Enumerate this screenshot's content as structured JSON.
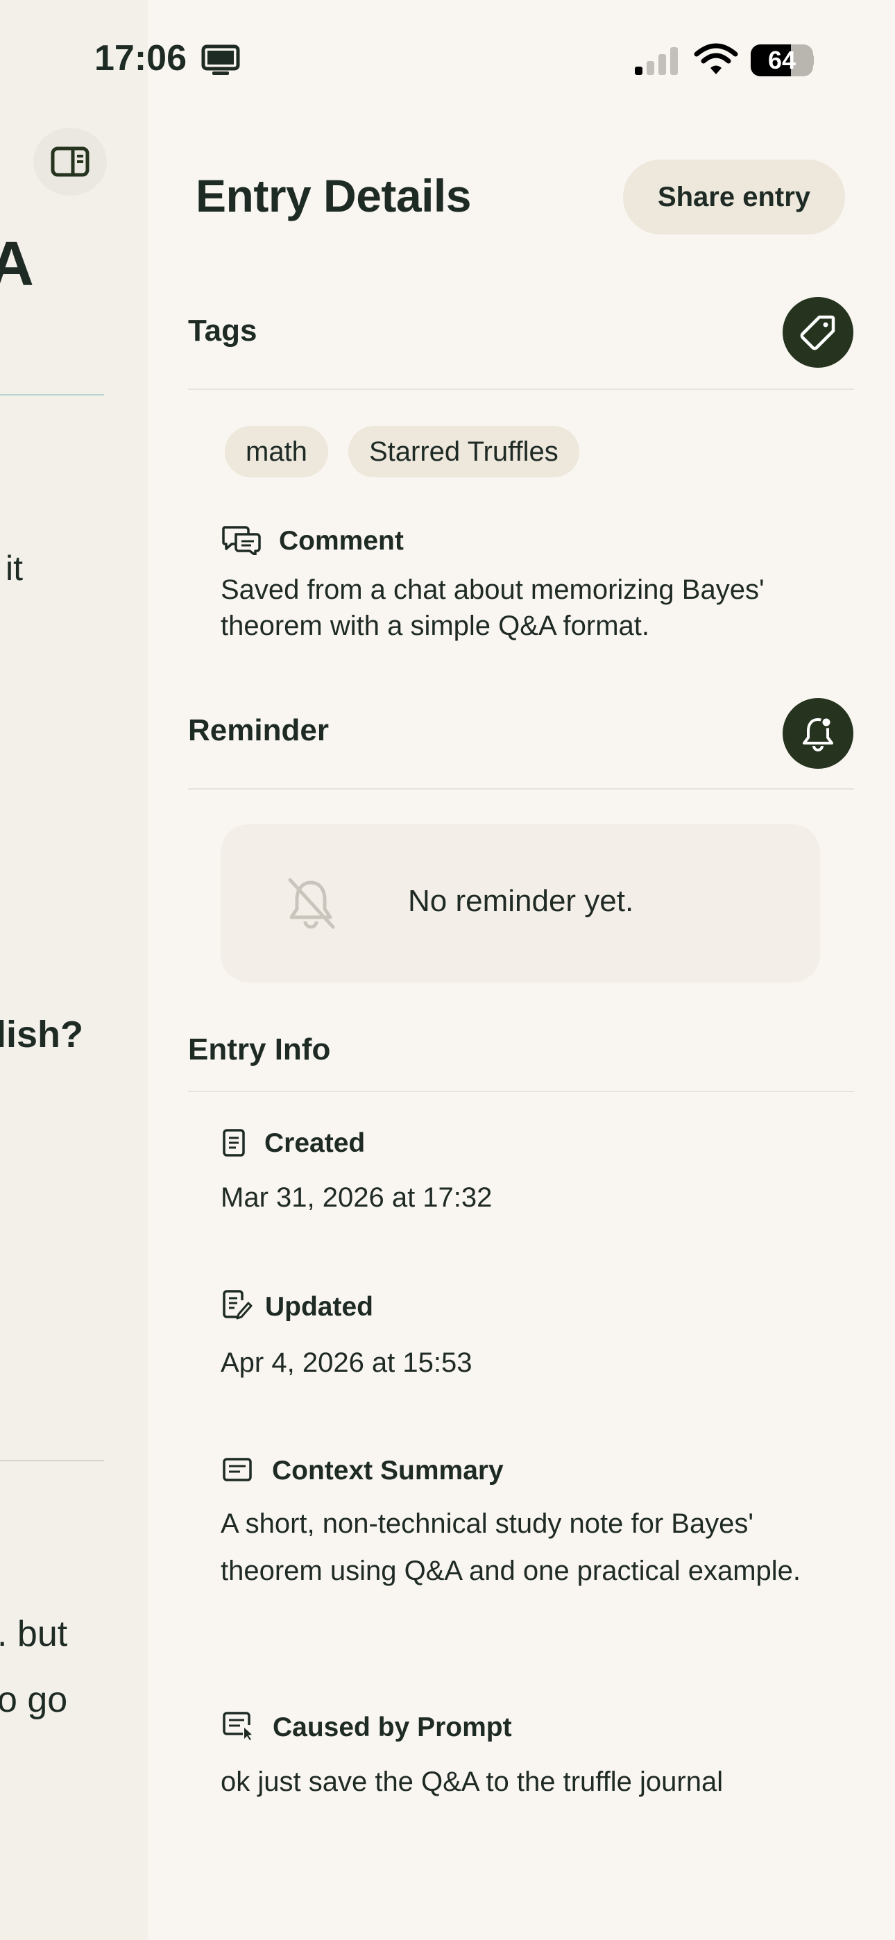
{
  "status_bar": {
    "time": "17:06",
    "battery": "64",
    "battery_level": 0.64
  },
  "background_fragments": {
    "a": "A",
    "it": "it",
    "lish": "lish?",
    "but": ". but",
    "go": "o go"
  },
  "header": {
    "title": "Entry Details",
    "share_label": "Share entry"
  },
  "tags": {
    "title": "Tags",
    "items": [
      "math",
      "Starred Truffles"
    ],
    "comment_label": "Comment",
    "comment_text": "Saved from a chat about memorizing Bayes' theorem with a simple Q&A format."
  },
  "reminder": {
    "title": "Reminder",
    "empty_text": "No reminder yet."
  },
  "entry_info": {
    "title": "Entry Info",
    "created_label": "Created",
    "created_value": "Mar 31, 2026 at 17:32",
    "updated_label": "Updated",
    "updated_value": "Apr 4, 2026 at 15:53",
    "context_label": "Context Summary",
    "context_value": "A short, non-technical study note for Bayes' theorem using Q&A and one practical example.",
    "prompt_label": "Caused by Prompt",
    "prompt_value": "ok just save the Q&A to the truffle journal"
  },
  "icons": {
    "tag": "tag-icon",
    "bell_add": "bell-add-icon",
    "bell_off": "bell-off-icon",
    "comment": "comment-icon",
    "created": "document-icon",
    "updated": "edit-document-icon",
    "context": "summary-icon",
    "prompt": "prompt-icon",
    "sidebar": "sidebar-icon"
  },
  "colors": {
    "background": "#f9f6f1",
    "accent_dark": "#25331f",
    "chip": "#ede7dc"
  }
}
